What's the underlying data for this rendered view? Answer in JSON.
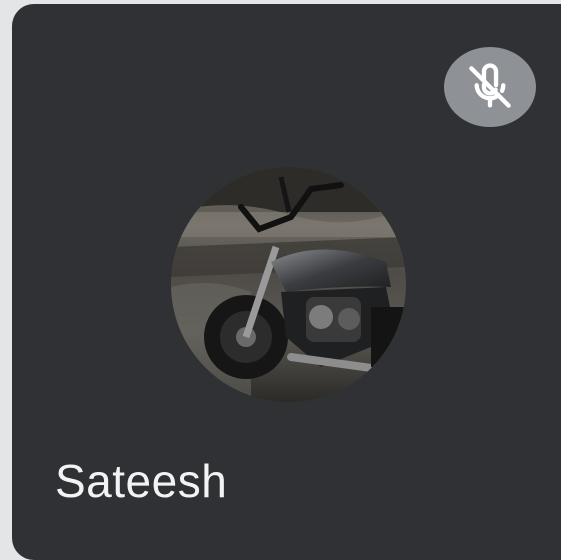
{
  "participant": {
    "name": "Sateesh",
    "mic_state": "muted",
    "mic_icon": "mic-off-icon",
    "avatar": "motorcycle-photo"
  },
  "colors": {
    "tile_background": "#303134",
    "badge_background": "#8e9196",
    "name_text": "#f1f3f4"
  }
}
